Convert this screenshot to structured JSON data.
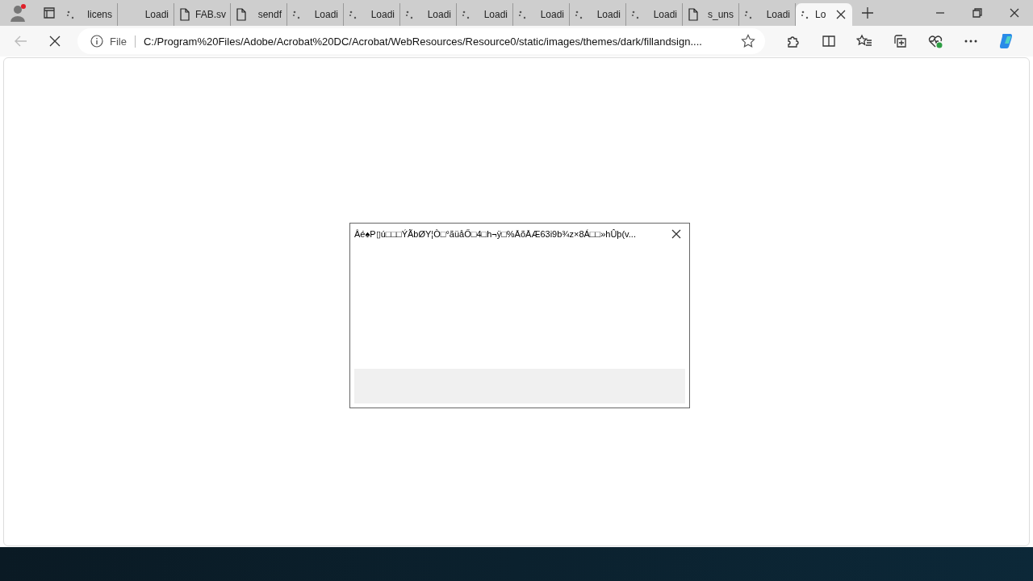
{
  "tabs": [
    {
      "kind": "spinner",
      "label": "licens",
      "selected": false
    },
    {
      "kind": "none",
      "label": "Loadi",
      "selected": false
    },
    {
      "kind": "file",
      "label": "FAB.sv",
      "selected": false
    },
    {
      "kind": "file",
      "label": "sendf",
      "selected": false
    },
    {
      "kind": "spinner",
      "label": "Loadi",
      "selected": false
    },
    {
      "kind": "spinner",
      "label": "Loadi",
      "selected": false
    },
    {
      "kind": "spinner",
      "label": "Loadi",
      "selected": false
    },
    {
      "kind": "spinner",
      "label": "Loadi",
      "selected": false
    },
    {
      "kind": "spinner",
      "label": "Loadi",
      "selected": false
    },
    {
      "kind": "spinner",
      "label": "Loadi",
      "selected": false
    },
    {
      "kind": "spinner",
      "label": "Loadi",
      "selected": false
    },
    {
      "kind": "file",
      "label": "s_uns",
      "selected": false
    },
    {
      "kind": "spinner",
      "label": "Loadi",
      "selected": false
    },
    {
      "kind": "spinner",
      "label": "Lo",
      "selected": true
    }
  ],
  "address_bar": {
    "scheme_label": "File",
    "url": "C:/Program%20Files/Adobe/Acrobat%20DC/Acrobat/WebResources/Resource0/static/images/themes/dark/fillandsign...."
  },
  "dialog": {
    "title": "Âé♠P▯ú□□□ÝÃbØY¦Ò□°ãüåŐ□4□h¬ÿ□%ĀõĀÆ63i9b¾z×8Á□□»hÛþ(v..."
  }
}
